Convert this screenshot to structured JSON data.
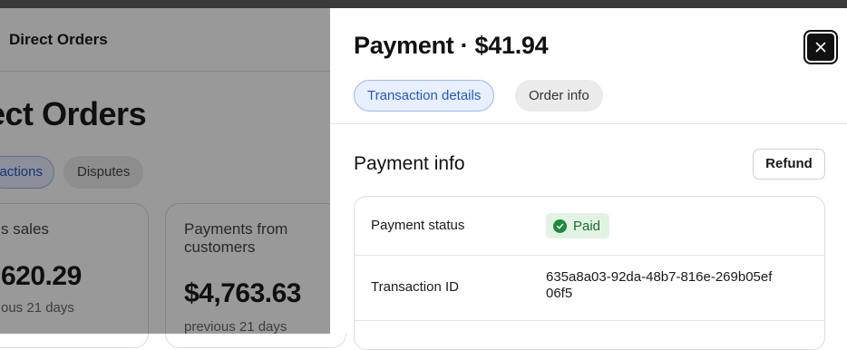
{
  "background": {
    "header_title": "Direct Orders",
    "page_heading": "ect Orders",
    "tabs": [
      {
        "label": "actions"
      },
      {
        "label": "Disputes"
      }
    ],
    "cards": [
      {
        "label": "s sales",
        "value": "620.29",
        "sub": "ous 21 days"
      },
      {
        "label": "Payments from customers",
        "value": "$4,763.63",
        "sub": "previous 21 days"
      }
    ]
  },
  "drawer": {
    "title": "Payment · $41.94",
    "close_icon": "close-icon",
    "tabs": [
      {
        "label": "Transaction details",
        "active": true
      },
      {
        "label": "Order info",
        "active": false
      }
    ],
    "section_title": "Payment info",
    "refund_label": "Refund",
    "rows": [
      {
        "label": "Payment status",
        "value": "Paid",
        "icon": "check-circle-icon"
      },
      {
        "label": "Transaction ID",
        "value": "635a8a03-92da-48b7-816e-269b05ef06f5"
      }
    ]
  },
  "colors": {
    "accent": "#2458c8",
    "accent_bg": "#e8efff",
    "success": "#1f8a3b",
    "success_bg": "#e2f3e4"
  }
}
